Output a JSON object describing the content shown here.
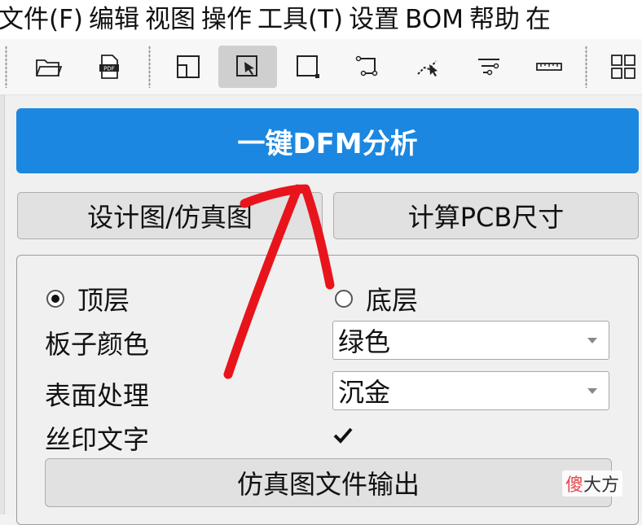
{
  "menu": [
    "文件(F)",
    "编辑",
    "视图",
    "操作",
    "工具(T)",
    "设置",
    "BOM",
    "帮助",
    "在"
  ],
  "toolbar": {
    "icons": [
      "folder-open-icon",
      "pdf-icon",
      "layout-icon",
      "select-cursor-icon",
      "board-outline-icon",
      "path-edit-icon",
      "node-select-icon",
      "trim-icon",
      "ruler-icon",
      "grid-icon"
    ],
    "active_icon": "select-cursor-icon"
  },
  "actions": {
    "dfm_button": "一键DFM分析",
    "design_view_button": "设计图/仿真图",
    "pcb_size_button": "计算PCB尺寸"
  },
  "layer": {
    "top_label": "顶层",
    "bottom_label": "底层",
    "selected": "top"
  },
  "settings": {
    "board_color_label": "板子颜色",
    "board_color_value": "绿色",
    "surface_label": "表面处理",
    "surface_value": "沉金",
    "silkscreen_label": "丝印文字",
    "silkscreen_checked": true
  },
  "export_button": "仿真图文件输出",
  "watermark": {
    "highlight": "傻",
    "rest": "大方"
  },
  "colors": {
    "accent": "#1b87e0",
    "annotation": "#e8141c"
  }
}
